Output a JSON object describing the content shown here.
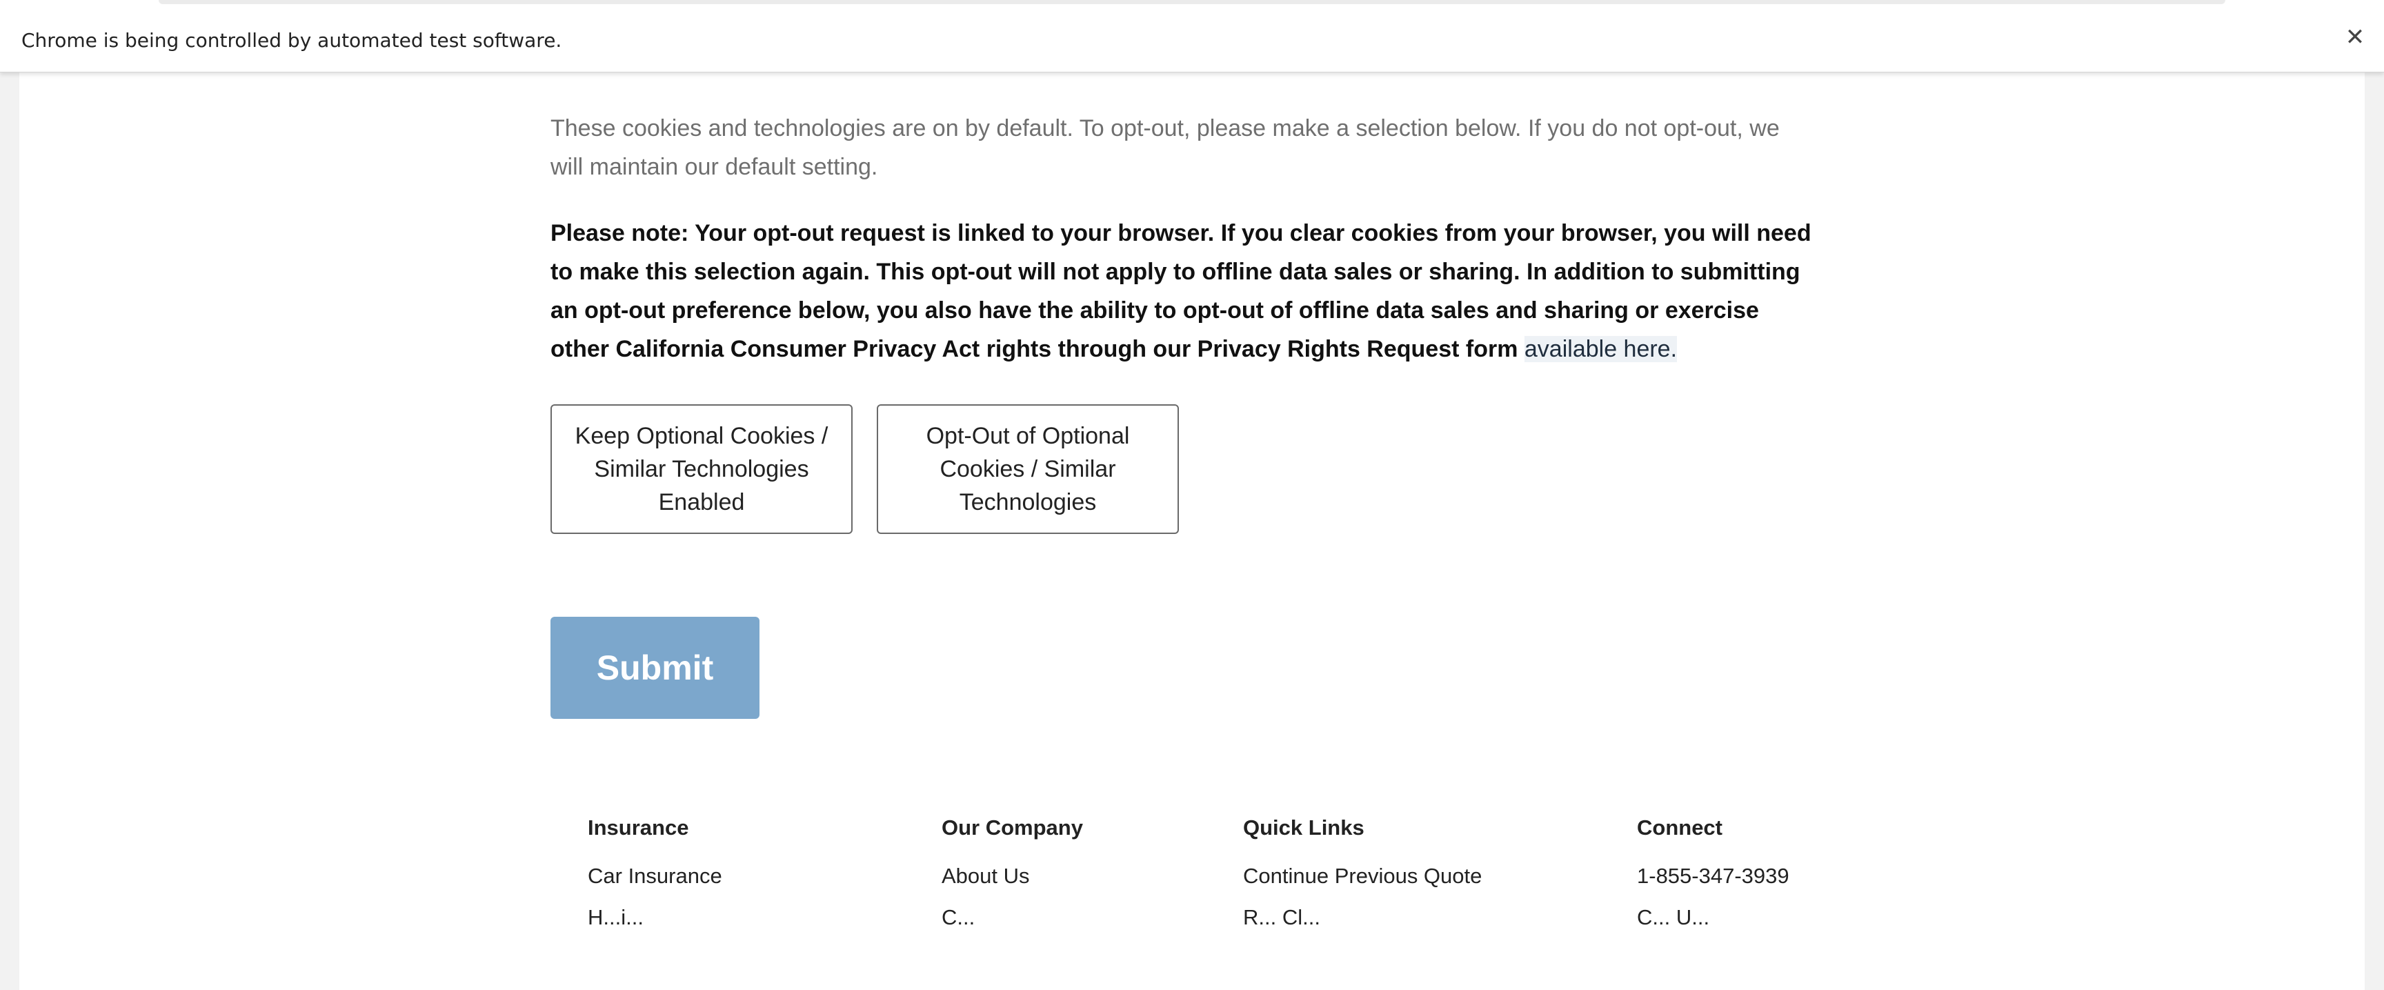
{
  "browser": {
    "automation_notice": "Chrome is being controlled by automated test software.",
    "close_glyph": "✕"
  },
  "main": {
    "default_paragraph": "These cookies and technologies are on by default. To opt-out, please make a selection below. If you do not opt-out, we will maintain our default setting.",
    "note_paragraph": "Please note: Your opt-out request is linked to your browser. If you clear cookies from your browser, you will need to make this selection again. This opt-out will not apply to offline data sales or sharing. In addition to submitting an opt-out preference below, you also have the ability to opt-out of offline data sales and sharing or exercise other California Consumer Privacy Act rights through our Privacy Rights Request form",
    "note_link": "available here.",
    "keep_button": "Keep Optional Cookies / Similar Technologies Enabled",
    "optout_button": "Opt-Out of Optional Cookies / Similar Technologies",
    "submit_button": "Submit"
  },
  "footer": {
    "insurance": {
      "heading": "Insurance",
      "first_link": "Car Insurance",
      "second_link_partial": "H...i..."
    },
    "company": {
      "heading": "Our Company",
      "first_link": "About Us",
      "second_link_partial": "C..."
    },
    "quick_links": {
      "heading": "Quick Links",
      "first_link": "Continue Previous Quote",
      "second_link_partial": "R... Cl..."
    },
    "connect": {
      "heading": "Connect",
      "first_link": "1-855-347-3939",
      "second_link_partial": "C... U..."
    }
  },
  "colors": {
    "submit_bg": "#7ca7cc",
    "body_text": "#111111",
    "muted_text": "#6f6f6f",
    "link_highlight": "#eef2f6"
  }
}
